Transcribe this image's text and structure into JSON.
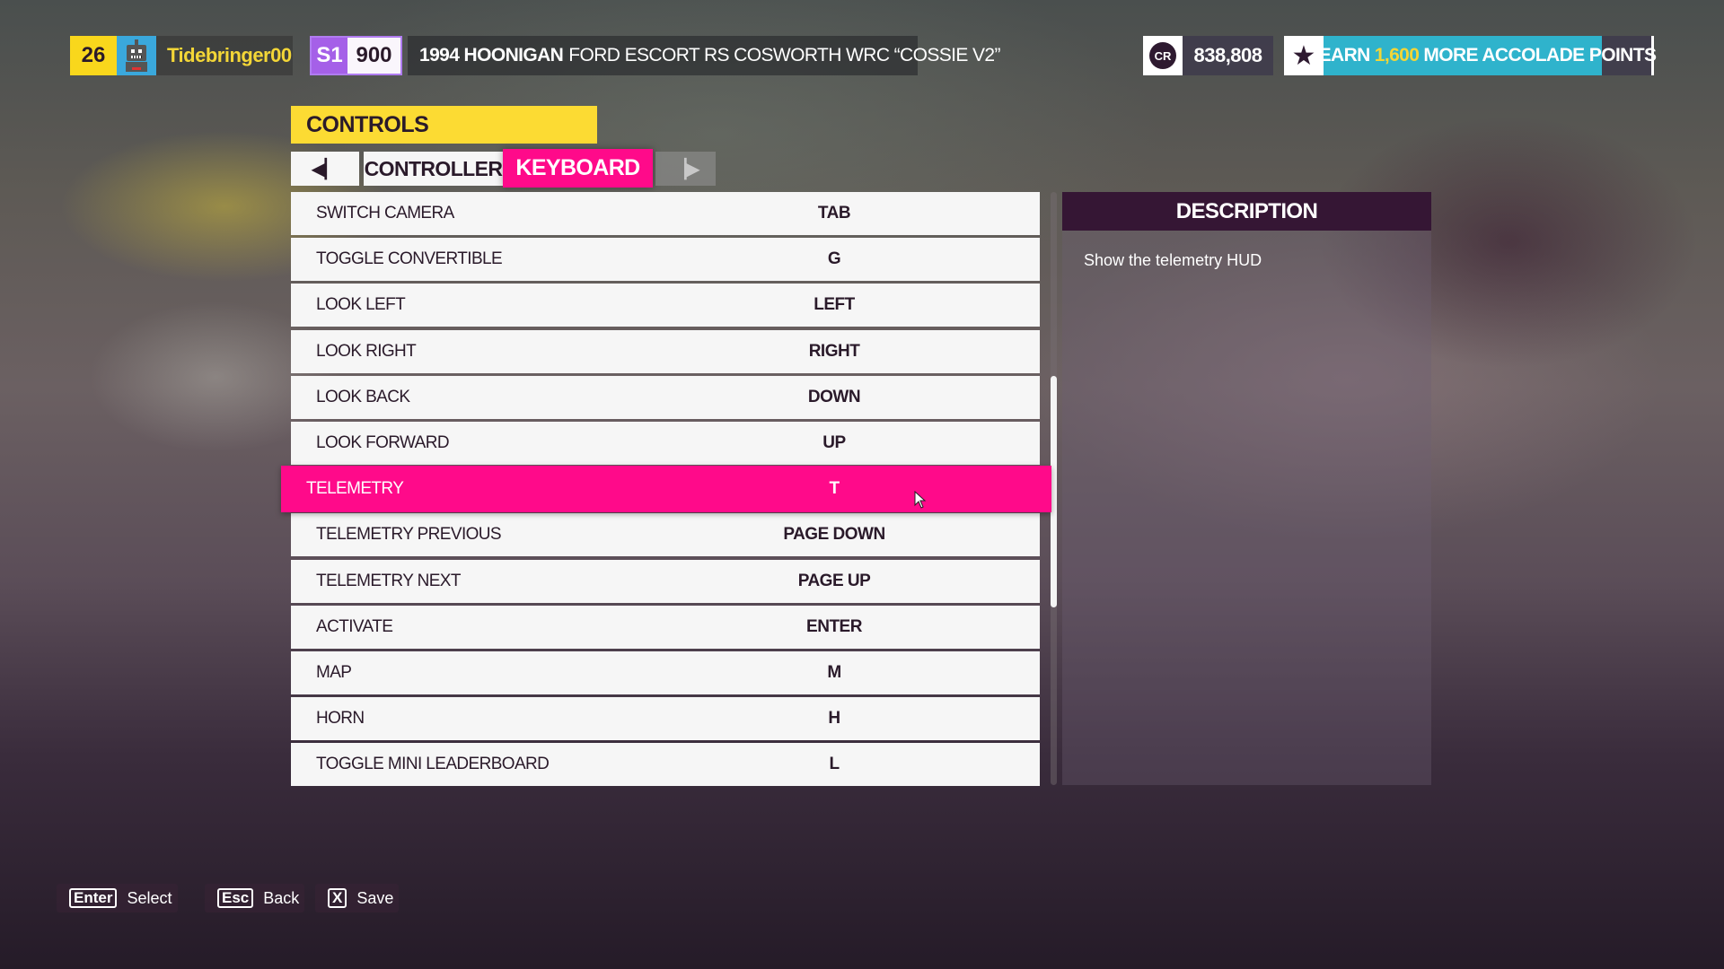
{
  "player": {
    "level": "26",
    "avatar_icon": "robot-avatar-icon",
    "gamertag": "Tidebringer00"
  },
  "car": {
    "class": "S1",
    "pi": "900",
    "year_make": "1994 HOONIGAN",
    "model": "FORD ESCORT RS COSWORTH WRC “COSSIE V2”"
  },
  "credits": {
    "icon": "CR",
    "amount": "838,808"
  },
  "accolade": {
    "icon": "accolade-star-icon",
    "prefix": "EARN",
    "points": "1,600",
    "suffix": "MORE ACCOLADE POINTS",
    "progress_fraction": 0.85,
    "fill_color": "#2fb3cc"
  },
  "screen": {
    "title": "CONTROLS"
  },
  "tabs": {
    "prev_icon": "◀▏",
    "next_icon": "▕▶",
    "items": [
      {
        "label": "CONTROLLER",
        "active": false
      },
      {
        "label": "KEYBOARD",
        "active": true
      }
    ]
  },
  "bindings": {
    "selected_index": 6,
    "rows": [
      {
        "action": "SWITCH CAMERA",
        "key": "TAB"
      },
      {
        "action": "TOGGLE CONVERTIBLE",
        "key": "G"
      },
      {
        "action": "LOOK LEFT",
        "key": "LEFT"
      },
      {
        "action": "LOOK RIGHT",
        "key": "RIGHT"
      },
      {
        "action": "LOOK BACK",
        "key": "DOWN"
      },
      {
        "action": "LOOK FORWARD",
        "key": "UP"
      },
      {
        "action": "TELEMETRY",
        "key": "T"
      },
      {
        "action": "TELEMETRY PREVIOUS",
        "key": "PAGE DOWN"
      },
      {
        "action": "TELEMETRY NEXT",
        "key": "PAGE UP"
      },
      {
        "action": "ACTIVATE",
        "key": "ENTER"
      },
      {
        "action": "MAP",
        "key": "M"
      },
      {
        "action": "HORN",
        "key": "H"
      },
      {
        "action": "TOGGLE MINI LEADERBOARD",
        "key": "L"
      }
    ],
    "scroll": {
      "thumb_start_fraction": 0.31,
      "thumb_size_fraction": 0.39
    }
  },
  "description": {
    "title": "DESCRIPTION",
    "text": "Show the telemetry HUD"
  },
  "footer": {
    "hints": [
      {
        "key": "Enter",
        "label": "Select"
      },
      {
        "key": "Esc",
        "label": "Back"
      },
      {
        "key": "X",
        "label": "Save"
      }
    ]
  },
  "colors": {
    "accent_pink": "#ff0a8a",
    "header_yellow": "#fcdb33",
    "description_header": "#351634",
    "class_purple": "#a560e8"
  }
}
